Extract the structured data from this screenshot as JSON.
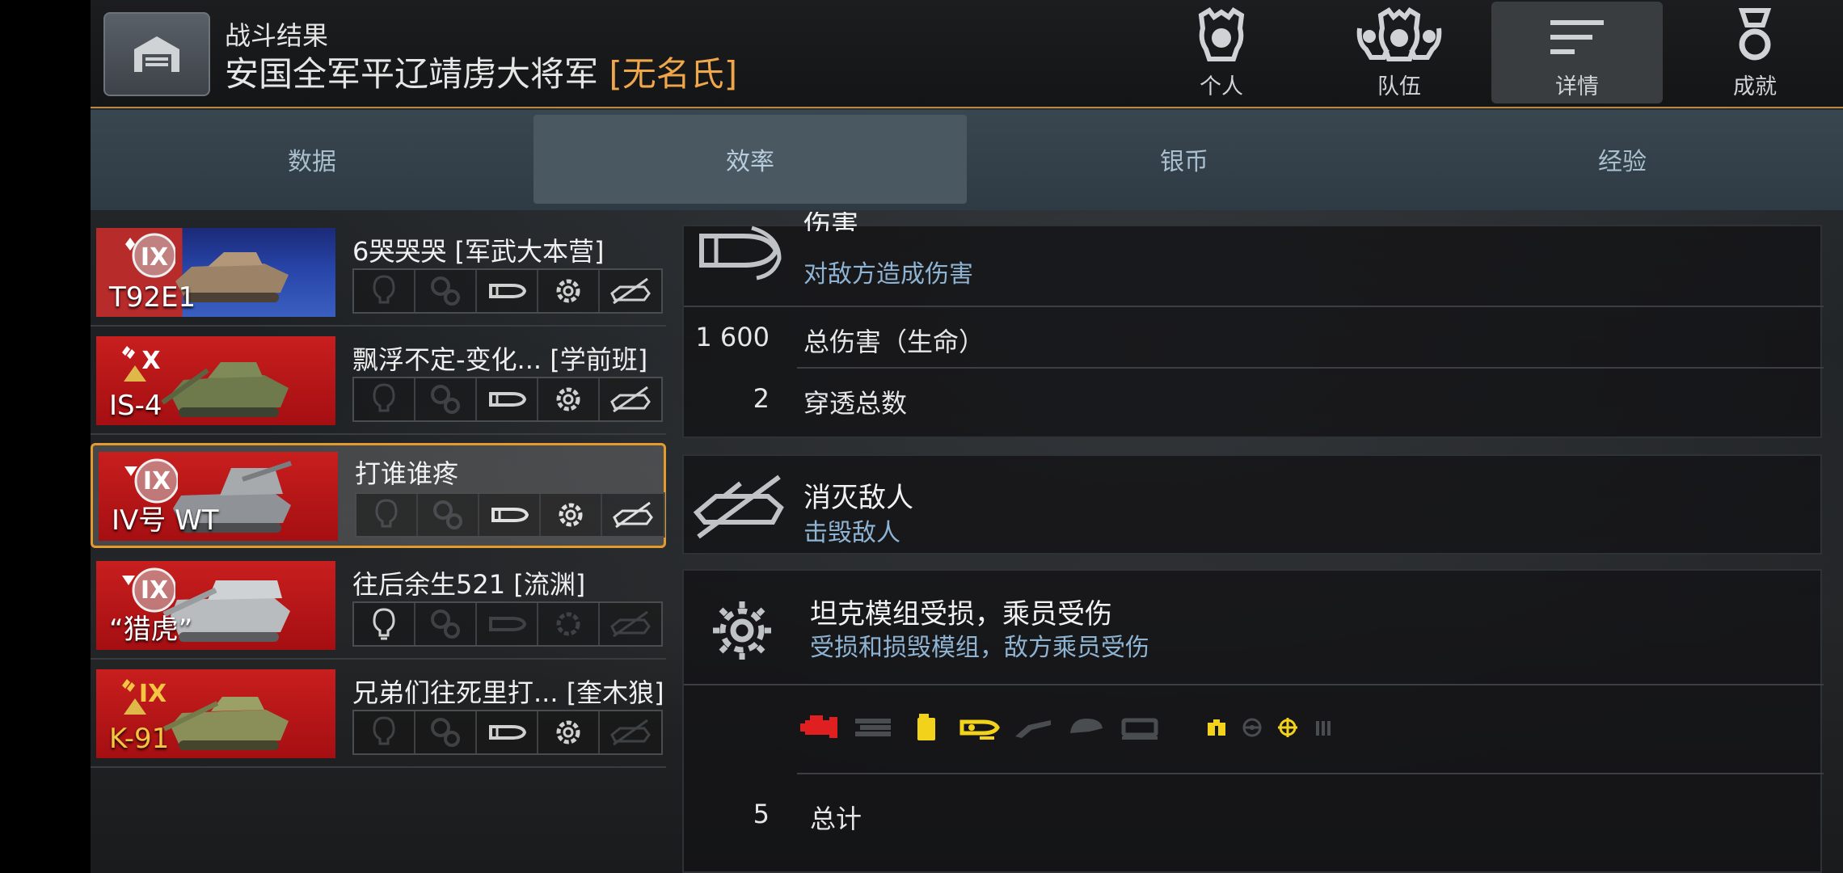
{
  "header": {
    "subtitle": "战斗结果",
    "player_title": "安国全军平辽靖虏大将军",
    "player_clan": "[无名氏]"
  },
  "top_tabs": [
    {
      "label": "个人",
      "icon": "helmet-icon"
    },
    {
      "label": "队伍",
      "icon": "team-helmets-icon"
    },
    {
      "label": "详情",
      "icon": "list-lines-icon",
      "active": true
    },
    {
      "label": "成就",
      "icon": "medal-icon"
    }
  ],
  "sub_tabs": [
    {
      "label": "数据"
    },
    {
      "label": "效率",
      "active": true
    },
    {
      "label": "银币"
    },
    {
      "label": "经验"
    }
  ],
  "players": [
    {
      "tank": "T92E1",
      "tier": "IX",
      "nation": "usa",
      "name": "6哭哭哭 [军武大本营]",
      "icons": {
        "spotting": false,
        "assist": false,
        "damage": true,
        "modules": true,
        "kills": true
      }
    },
    {
      "tank": "IS-4",
      "tier": "X",
      "nation": "ussr",
      "name": "飘浮不定-变化...  [学前班]",
      "icons": {
        "spotting": false,
        "assist": false,
        "damage": true,
        "modules": true,
        "kills": true
      }
    },
    {
      "tank": "IV号 WT",
      "tier": "IX",
      "nation": "germany",
      "name": "打谁谁疼",
      "self": true,
      "icons": {
        "spotting": false,
        "assist": false,
        "damage": true,
        "modules": true,
        "kills": true
      }
    },
    {
      "tank": "“猎虎”",
      "tier": "IX",
      "nation": "germany",
      "name": "往后余生521 [流渊]",
      "icons": {
        "spotting": true,
        "assist": false,
        "damage": false,
        "modules": false,
        "kills": false
      }
    },
    {
      "tank": "K-91",
      "tier": "IX",
      "nation": "ussr",
      "name": "兄弟们往死里打... [奎木狼]",
      "premium": true,
      "icons": {
        "spotting": false,
        "assist": false,
        "damage": true,
        "modules": true,
        "kills": false
      }
    }
  ],
  "damage_section": {
    "title": "伤害",
    "desc": "对敌方造成伤害",
    "rows": [
      {
        "value": "1 600",
        "label": "总伤害（生命）"
      },
      {
        "value": "2",
        "label": "穿透总数"
      }
    ]
  },
  "kills_section": {
    "title": "消灭敌人",
    "desc": "击毁敌人"
  },
  "modules_section": {
    "title": "坦克模组受损，乘员受伤",
    "desc": "受损和损毁模组，敌方乘员受伤",
    "module_icons": [
      {
        "name": "engine-icon",
        "state": "destroyed",
        "color": "#e02020"
      },
      {
        "name": "tracks-icon",
        "state": "intact",
        "color": "#4a4d50"
      },
      {
        "name": "fuel-tank-icon",
        "state": "damaged",
        "color": "#f2d21a"
      },
      {
        "name": "ammo-rack-icon",
        "state": "damaged",
        "color": "#f2d21a"
      },
      {
        "name": "gun-icon",
        "state": "intact",
        "color": "#4a4d50"
      },
      {
        "name": "turret-icon",
        "state": "intact",
        "color": "#4a4d50"
      },
      {
        "name": "radio-icon",
        "state": "intact",
        "color": "#4a4d50"
      },
      {
        "name": "binoculars-crew-icon",
        "state": "damaged",
        "color": "#f2d21a"
      },
      {
        "name": "driver-crew-icon",
        "state": "intact",
        "color": "#4a4d50"
      },
      {
        "name": "gunner-crew-icon",
        "state": "damaged",
        "color": "#f2d21a"
      },
      {
        "name": "loader-crew-icon",
        "state": "intact",
        "color": "#4a4d50"
      }
    ],
    "total_value": "5",
    "total_label": "总计"
  },
  "colors": {
    "accent": "#e39a2e",
    "clan": "#f0a64a",
    "desc": "#8fb4d3",
    "warning": "#f2d21a",
    "critical": "#e02020"
  }
}
